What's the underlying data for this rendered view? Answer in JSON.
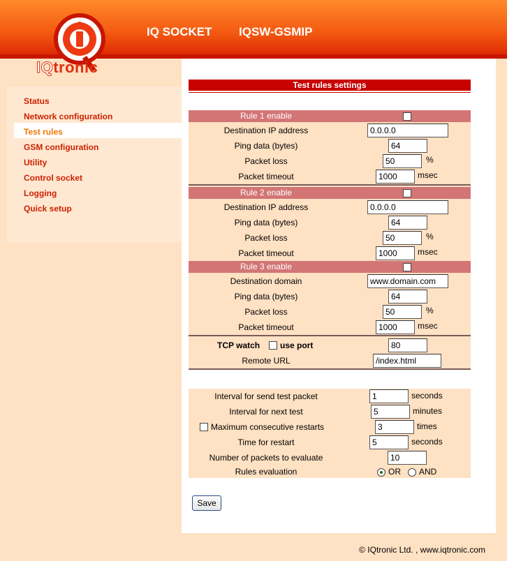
{
  "header": {
    "logo_text_red": "IQ",
    "logo_text_rest": "tronic",
    "title1": "IQ SOCKET",
    "title2": "IQSW-GSMIP"
  },
  "sidebar": {
    "items": [
      {
        "label": "Status"
      },
      {
        "label": "Network configuration"
      },
      {
        "label": "Test rules",
        "active": true
      },
      {
        "label": "GSM configuration"
      },
      {
        "label": "Utility"
      },
      {
        "label": "Control socket"
      },
      {
        "label": "Logging"
      },
      {
        "label": "Quick setup"
      }
    ]
  },
  "main": {
    "section_title": "Test rules settings",
    "rule1": {
      "enable_label": "Rule 1 enable",
      "enabled": false,
      "target_label": "Destination IP address",
      "target_value": "0.0.0.0",
      "ping_label": "Ping data (bytes)",
      "ping_value": "64",
      "loss_label": "Packet loss",
      "loss_value": "50",
      "loss_unit": "%",
      "timeout_label": "Packet timeout",
      "timeout_value": "1000",
      "timeout_unit": "msec"
    },
    "rule2": {
      "enable_label": "Rule 2 enable",
      "enabled": false,
      "target_label": "Destination IP address",
      "target_value": "0.0.0.0",
      "ping_label": "Ping data (bytes)",
      "ping_value": "64",
      "loss_label": "Packet loss",
      "loss_value": "50",
      "loss_unit": "%",
      "timeout_label": "Packet timeout",
      "timeout_value": "1000",
      "timeout_unit": "msec"
    },
    "rule3": {
      "enable_label": "Rule 3 enable",
      "enabled": false,
      "target_label": "Destination domain",
      "target_value": "www.domain.com",
      "ping_label": "Ping data (bytes)",
      "ping_value": "64",
      "loss_label": "Packet loss",
      "loss_value": "50",
      "loss_unit": "%",
      "timeout_label": "Packet timeout",
      "timeout_value": "1000",
      "timeout_unit": "msec"
    },
    "tcp": {
      "watch_label": "TCP watch",
      "use_port_label": "use port",
      "use_port_checked": false,
      "port_value": "80",
      "url_label": "Remote URL",
      "url_value": "/index.html"
    },
    "general": {
      "interval_send_label": "Interval for send test packet",
      "interval_send_value": "1",
      "interval_send_unit": "seconds",
      "interval_next_label": "Interval for next test",
      "interval_next_value": "5",
      "interval_next_unit": "minutes",
      "max_restarts_label": "Maximum consecutive restarts",
      "max_restarts_checked": false,
      "max_restarts_value": "3",
      "max_restarts_unit": "times",
      "restart_time_label": "Time for restart",
      "restart_time_value": "5",
      "restart_time_unit": "seconds",
      "packets_eval_label": "Number of packets to evaluate",
      "packets_eval_value": "10",
      "rules_eval_label": "Rules evaluation",
      "rules_eval_or": "OR",
      "rules_eval_and": "AND",
      "rules_eval_selected": "OR"
    },
    "save_label": "Save"
  },
  "footer": {
    "text": "© IQtronic Ltd. , www.iqtronic.com"
  },
  "colors": {
    "accent": "#c80000",
    "rule_header": "#d37575",
    "form_bg": "#ffe1c3",
    "nav_text": "#cc2200"
  }
}
